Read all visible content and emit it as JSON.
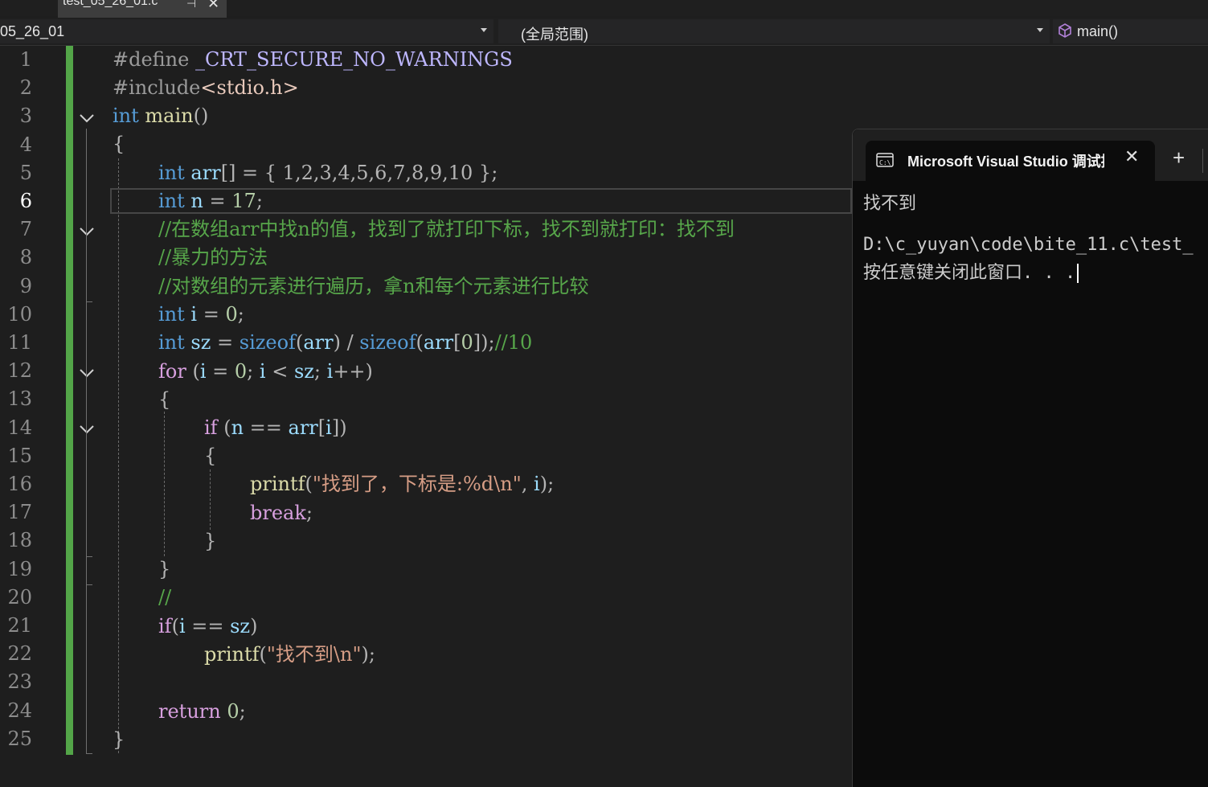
{
  "tab": {
    "filename": "test_05_26_01.c",
    "pin_icon": "pin-icon",
    "close_icon": "close-icon"
  },
  "navbar": {
    "project": "05_26_01",
    "scope": "(全局范围)",
    "function": "main()",
    "function_icon": "cube-icon"
  },
  "editor": {
    "current_line": 6,
    "line_numbers": [
      "1",
      "2",
      "3",
      "4",
      "5",
      "6",
      "7",
      "8",
      "9",
      "10",
      "11",
      "12",
      "13",
      "14",
      "15",
      "16",
      "17",
      "18",
      "19",
      "20",
      "21",
      "22",
      "23",
      "24",
      "25"
    ],
    "code": {
      "l1_directive": "#define",
      "l1_macro": "_CRT_SECURE_NO_WARNINGS",
      "l2_directive": "#include",
      "l2_header": "<stdio.h>",
      "l3_type": "int",
      "l3_name": "main",
      "l3_parens": "()",
      "l4_brace": "{",
      "l5_type": "int",
      "l5_name": "arr",
      "l5_rest": "[] = { 1,2,3,4,5,6,7,8,9,10 };",
      "l6_type": "int",
      "l6_name": "n",
      "l6_eq": " = ",
      "l6_num": "17",
      "l6_semi": ";",
      "l7_comment": "//在数组arr中找n的值，找到了就打印下标，找不到就打印：找不到",
      "l8_comment": "//暴力的方法",
      "l9_comment": "//对数组的元素进行遍历，拿n和每个元素进行比较",
      "l10_type": "int",
      "l10_name": "i",
      "l10_eq": " = ",
      "l10_num": "0",
      "l10_semi": ";",
      "l11_type": "int",
      "l11_name": "sz",
      "l11_eq": " = ",
      "l11_sizeof1": "sizeof",
      "l11_p1": "(",
      "l11_arr1": "arr",
      "l11_p2": ") / ",
      "l11_sizeof2": "sizeof",
      "l11_p3": "(",
      "l11_arr2": "arr",
      "l11_br1": "[",
      "l11_zero": "0",
      "l11_p4": "]);",
      "l11_comment": "//10",
      "l12_for": "for",
      "l12_p1": " (",
      "l12_i1": "i",
      "l12_eq": " = ",
      "l12_zero": "0",
      "l12_semi1": "; ",
      "l12_i2": "i",
      "l12_lt": " < ",
      "l12_sz": "sz",
      "l12_semi2": "; ",
      "l12_i3": "i",
      "l12_inc": "++)",
      "l13_brace": "{",
      "l14_if": "if",
      "l14_p1": " (",
      "l14_n": "n",
      "l14_eq": " == ",
      "l14_arr": "arr",
      "l14_br1": "[",
      "l14_i": "i",
      "l14_br2": "])",
      "l15_brace": "{",
      "l16_fn": "printf",
      "l16_p1": "(",
      "l16_str": "\"找到了，下标是:",
      "l16_fmt": "%d\\n",
      "l16_strend": "\"",
      "l16_comma": ", ",
      "l16_i": "i",
      "l16_p2": ");",
      "l17_break": "break",
      "l17_semi": ";",
      "l18_brace": "}",
      "l19_brace": "}",
      "l20_comment": "//",
      "l21_if": "if",
      "l21_p1": "(",
      "l21_i": "i",
      "l21_eq": " == ",
      "l21_sz": "sz",
      "l21_p2": ")",
      "l22_fn": "printf",
      "l22_p1": "(",
      "l22_str": "\"找不到",
      "l22_esc": "\\n",
      "l22_strend": "\"",
      "l22_p2": ");",
      "l24_return": "return",
      "l24_zero": "0",
      "l24_semi": ";",
      "l25_brace": "}"
    }
  },
  "terminal": {
    "title": "Microsoft Visual Studio 调试控制台",
    "icon": "console-icon",
    "output_line1": "找不到",
    "output_line2": "D:\\c_yuyan\\code\\bite_11.c\\test_",
    "output_line3": "按任意键关闭此窗口. . ."
  },
  "colors": {
    "background": "#1e1e1e",
    "keyword": "#569cd6",
    "comment": "#57a64a",
    "string": "#e8c9bb",
    "number": "#b5cea8",
    "function": "#dcdcaa",
    "variable": "#9cdcfe",
    "control": "#d8a0df",
    "change_bar": "#53a548",
    "terminal_bg": "#0c0c0c"
  }
}
